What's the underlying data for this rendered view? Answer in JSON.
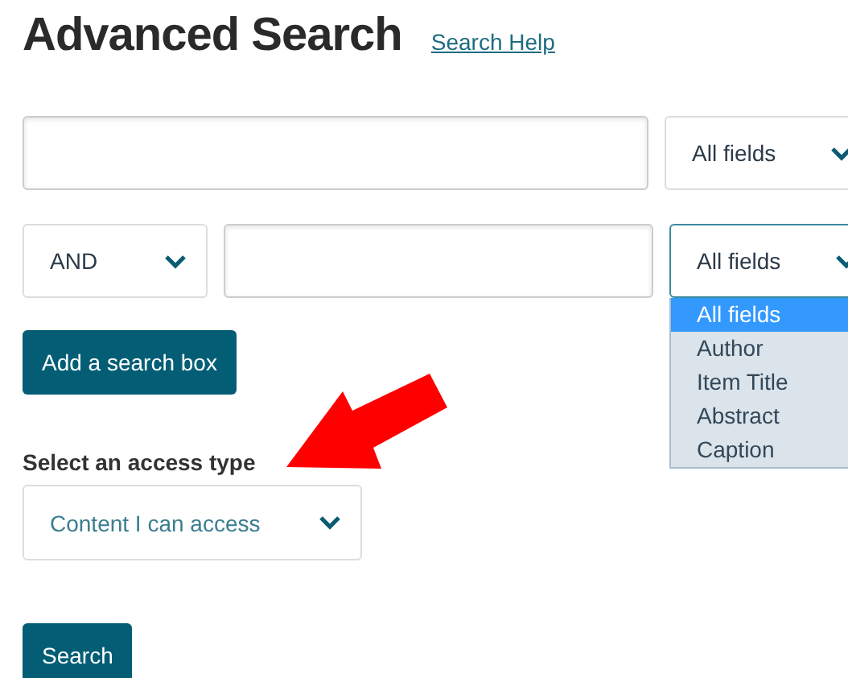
{
  "title": "Advanced Search",
  "help_link": "Search Help",
  "rows": [
    {
      "field": "All fields",
      "open": false
    },
    {
      "operator": "AND",
      "field": "All fields",
      "open": true,
      "options": [
        {
          "label": "All fields",
          "selected": true
        },
        {
          "label": "Author",
          "selected": false
        },
        {
          "label": "Item Title",
          "selected": false
        },
        {
          "label": "Abstract",
          "selected": false
        },
        {
          "label": "Caption",
          "selected": false
        }
      ]
    }
  ],
  "add_button": "Add a search box",
  "access": {
    "label": "Select an access type",
    "value": "Content I can access"
  },
  "search_button": "Search"
}
